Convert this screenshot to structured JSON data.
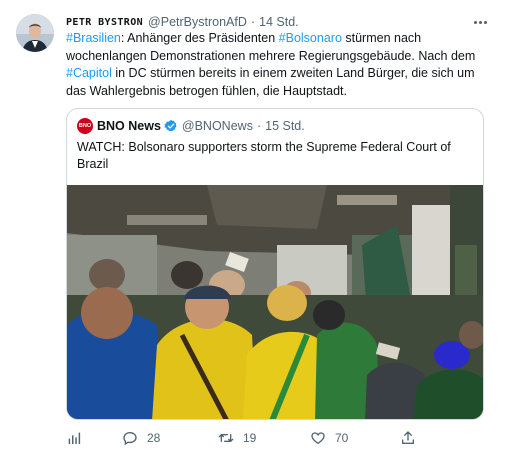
{
  "author": {
    "display_name": "PETR BYSTRON",
    "handle": "@PetrBystronAfD",
    "separator": "·",
    "time": "14 Std."
  },
  "tweet_text": {
    "segments": [
      {
        "text": "#Brasilien",
        "type": "hashtag"
      },
      {
        "text": ": Anhänger des Präsidenten ",
        "type": "text"
      },
      {
        "text": "#Bolsonaro",
        "type": "hashtag"
      },
      {
        "text": " stürmen nach wochenlangen Demonstrationen mehrere Regierungsgebäude. Nach dem ",
        "type": "text"
      },
      {
        "text": "#Capitol",
        "type": "hashtag"
      },
      {
        "text": " in DC stürmen bereits in einem zweiten Land Bürger, die sich um das Wahlergebnis betrogen fühlen, die Hauptstadt.",
        "type": "text"
      }
    ]
  },
  "quoted_tweet": {
    "logo_text": "BNO",
    "display_name": "BNO News",
    "handle": "@BNONews",
    "separator": "·",
    "time": "15 Std.",
    "text": "WATCH: Bolsonaro supporters storm the Supreme Federal Court of Brazil"
  },
  "actions": {
    "analytics_icon": "analytics-icon",
    "reply_icon": "reply-icon",
    "reply_count": "28",
    "retweet_icon": "retweet-icon",
    "retweet_count": "19",
    "like_icon": "like-icon",
    "like_count": "70",
    "share_icon": "share-icon"
  },
  "colors": {
    "hashtag": "#1d9bf0",
    "secondary_text": "#536471",
    "border": "#cfd9de",
    "verified": "#1d9bf0",
    "bno_red": "#d0021b"
  }
}
